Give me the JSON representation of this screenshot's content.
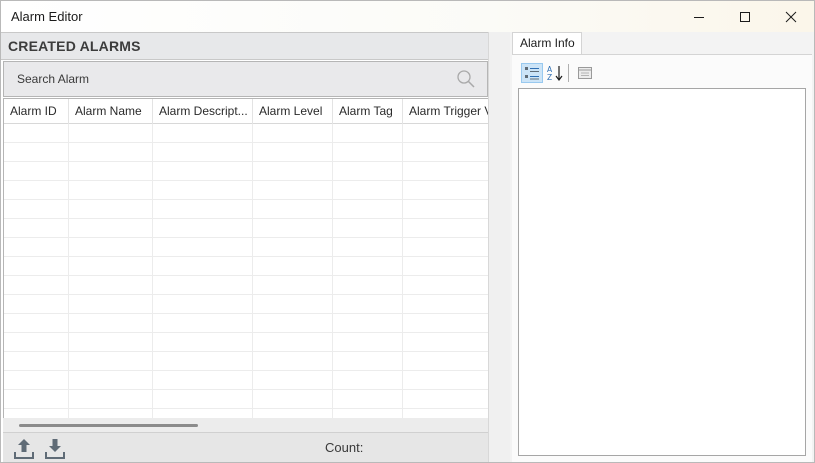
{
  "window": {
    "title": "Alarm Editor"
  },
  "left": {
    "header_title": "CREATED ALARMS",
    "search": {
      "label": "Search Alarm"
    },
    "columns": [
      "Alarm ID",
      "Alarm Name",
      "Alarm Descript...",
      "Alarm Level",
      "Alarm Tag",
      "Alarm Trigger V"
    ],
    "footer": {
      "count_label": "Count:"
    }
  },
  "right": {
    "tab_label": "Alarm Info"
  },
  "colors": {
    "accent_active": "#cce4f7",
    "accent_border": "#99c9ef",
    "icon_gray": "#5f6b76",
    "icon_blue": "#2f6fb3"
  }
}
